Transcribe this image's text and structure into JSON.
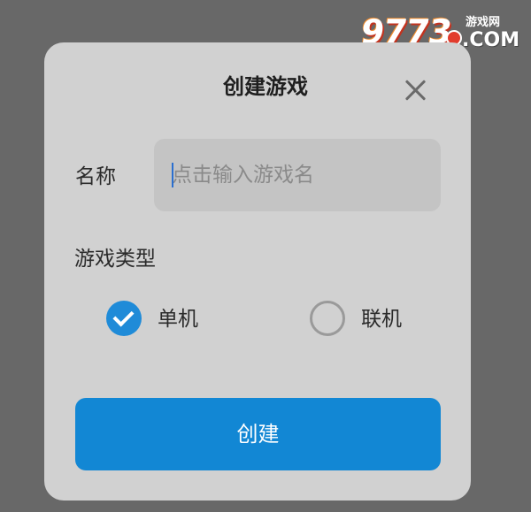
{
  "watermark": {
    "digits": "9773",
    "cn_text": "游戏网",
    "com_text": ".COM"
  },
  "dialog": {
    "title": "创建游戏",
    "close_icon": "close-icon",
    "name_field": {
      "label": "名称",
      "placeholder": "点击输入游戏名",
      "value": ""
    },
    "game_type": {
      "label": "游戏类型",
      "options": [
        {
          "label": "单机",
          "selected": true
        },
        {
          "label": "联机",
          "selected": false
        }
      ]
    },
    "create_button_label": "创建"
  },
  "colors": {
    "backdrop": "#686868",
    "dialog_bg": "#d1d1d1",
    "input_bg": "#c4c4c4",
    "accent": "#1287d4",
    "radio_checked": "#1f8bd8"
  }
}
